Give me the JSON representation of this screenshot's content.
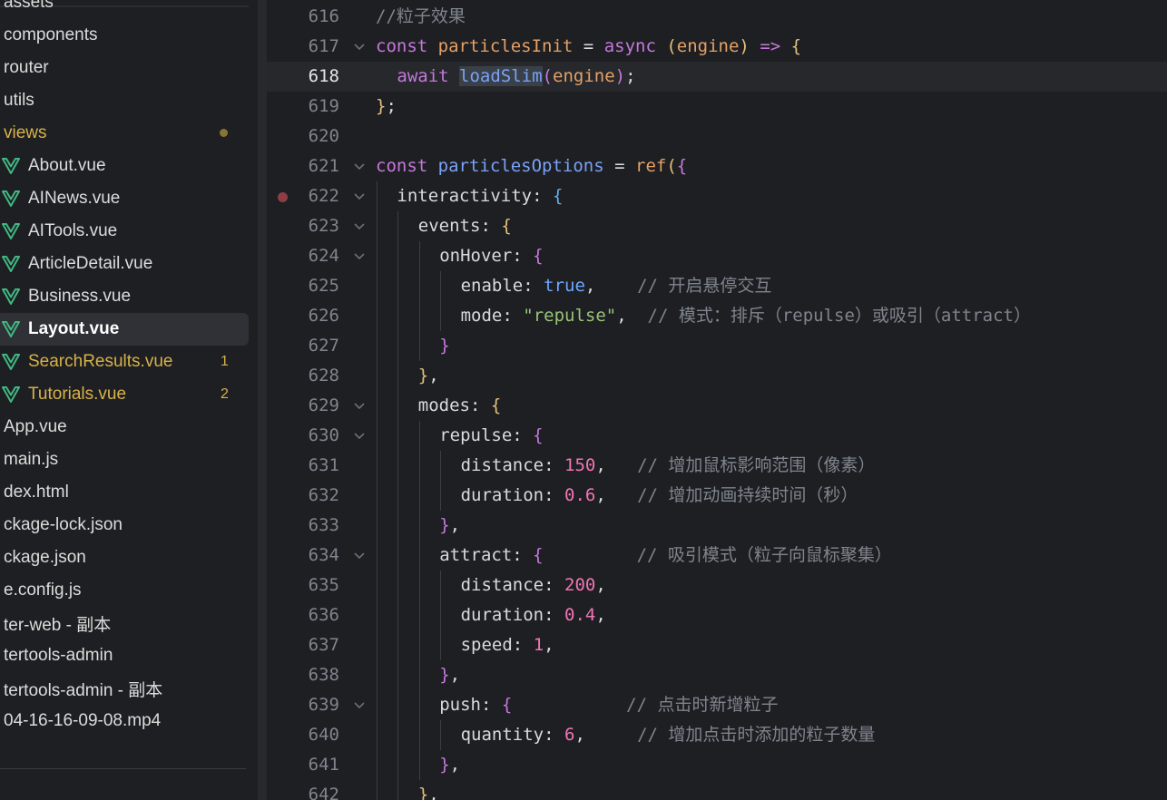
{
  "sidebar": {
    "items": [
      {
        "label": "assets",
        "type": "folder",
        "state": "normal",
        "badge": ""
      },
      {
        "label": "components",
        "type": "folder",
        "state": "normal",
        "badge": ""
      },
      {
        "label": "router",
        "type": "folder",
        "state": "normal",
        "badge": ""
      },
      {
        "label": "utils",
        "type": "folder",
        "state": "normal",
        "badge": ""
      },
      {
        "label": "views",
        "type": "folder",
        "state": "modified",
        "badge": "dot"
      },
      {
        "label": "About.vue",
        "type": "vue",
        "state": "normal",
        "badge": ""
      },
      {
        "label": "AINews.vue",
        "type": "vue",
        "state": "normal",
        "badge": ""
      },
      {
        "label": "AITools.vue",
        "type": "vue",
        "state": "normal",
        "badge": ""
      },
      {
        "label": "ArticleDetail.vue",
        "type": "vue",
        "state": "normal",
        "badge": ""
      },
      {
        "label": "Business.vue",
        "type": "vue",
        "state": "normal",
        "badge": ""
      },
      {
        "label": "Layout.vue",
        "type": "vue",
        "state": "active",
        "badge": ""
      },
      {
        "label": "SearchResults.vue",
        "type": "vue",
        "state": "modified",
        "badge": "1"
      },
      {
        "label": "Tutorials.vue",
        "type": "vue",
        "state": "modified",
        "badge": "2"
      },
      {
        "label": "App.vue",
        "type": "file",
        "state": "normal",
        "badge": ""
      },
      {
        "label": "main.js",
        "type": "file",
        "state": "normal",
        "badge": ""
      },
      {
        "label": "dex.html",
        "type": "file",
        "state": "normal",
        "badge": ""
      },
      {
        "label": "ckage-lock.json",
        "type": "file",
        "state": "normal",
        "badge": ""
      },
      {
        "label": "ckage.json",
        "type": "file",
        "state": "normal",
        "badge": ""
      },
      {
        "label": "e.config.js",
        "type": "file",
        "state": "normal",
        "badge": ""
      },
      {
        "label": "ter-web - 副本",
        "type": "folder",
        "state": "normal",
        "badge": ""
      },
      {
        "label": "tertools-admin",
        "type": "folder",
        "state": "normal",
        "badge": ""
      },
      {
        "label": "tertools-admin - 副本",
        "type": "folder",
        "state": "normal",
        "badge": ""
      },
      {
        "label": "04-16-16-09-08.mp4",
        "type": "file",
        "state": "normal",
        "badge": ""
      }
    ]
  },
  "editor": {
    "current_line": 618,
    "lines": [
      {
        "n": "616",
        "indent": 0,
        "fold": false,
        "bp": false,
        "t": [
          [
            "//粒子效果",
            "cmt"
          ]
        ]
      },
      {
        "n": "617",
        "indent": 0,
        "fold": true,
        "bp": false,
        "t": [
          [
            "const ",
            "kw"
          ],
          [
            "particlesInit",
            "fn"
          ],
          [
            " = ",
            "op"
          ],
          [
            "async ",
            "kw"
          ],
          [
            "(",
            "p1"
          ],
          [
            "engine",
            "fn"
          ],
          [
            ")",
            "p1"
          ],
          [
            " => ",
            "kw"
          ],
          [
            "{",
            "p1"
          ]
        ]
      },
      {
        "n": "618",
        "indent": 1,
        "fold": false,
        "bp": false,
        "t": [
          [
            "await ",
            "kw"
          ],
          [
            "loadSlim",
            "id hl"
          ],
          [
            "(",
            "p2"
          ],
          [
            "engine",
            "fn"
          ],
          [
            ")",
            "p2"
          ],
          [
            ";",
            "op"
          ]
        ]
      },
      {
        "n": "619",
        "indent": 0,
        "fold": false,
        "bp": false,
        "t": [
          [
            "}",
            "p1"
          ],
          [
            ";",
            "op"
          ]
        ]
      },
      {
        "n": "620",
        "indent": 0,
        "fold": false,
        "bp": false,
        "t": []
      },
      {
        "n": "621",
        "indent": 0,
        "fold": true,
        "bp": false,
        "t": [
          [
            "const ",
            "kw"
          ],
          [
            "particlesOptions",
            "id"
          ],
          [
            " = ",
            "op"
          ],
          [
            "ref",
            "fn"
          ],
          [
            "(",
            "p1"
          ],
          [
            "{",
            "p2"
          ]
        ]
      },
      {
        "n": "622",
        "indent": 1,
        "fold": true,
        "bp": true,
        "t": [
          [
            "interactivity",
            "prop"
          ],
          [
            ": ",
            "op"
          ],
          [
            "{",
            "p3"
          ]
        ]
      },
      {
        "n": "623",
        "indent": 2,
        "fold": true,
        "bp": false,
        "t": [
          [
            "events",
            "prop"
          ],
          [
            ": ",
            "op"
          ],
          [
            "{",
            "p1"
          ]
        ]
      },
      {
        "n": "624",
        "indent": 3,
        "fold": true,
        "bp": false,
        "t": [
          [
            "onHover",
            "prop"
          ],
          [
            ": ",
            "op"
          ],
          [
            "{",
            "p2"
          ]
        ]
      },
      {
        "n": "625",
        "indent": 4,
        "fold": false,
        "bp": false,
        "t": [
          [
            "enable",
            "prop"
          ],
          [
            ": ",
            "op"
          ],
          [
            "true",
            "bool"
          ],
          [
            ",    ",
            "op"
          ],
          [
            "// 开启悬停交互",
            "cmt"
          ]
        ]
      },
      {
        "n": "626",
        "indent": 4,
        "fold": false,
        "bp": false,
        "t": [
          [
            "mode",
            "prop"
          ],
          [
            ": ",
            "op"
          ],
          [
            "\"repulse\"",
            "str"
          ],
          [
            ",  ",
            "op"
          ],
          [
            "// 模式：排斥（repulse）或吸引（attract）",
            "cmt"
          ]
        ]
      },
      {
        "n": "627",
        "indent": 3,
        "fold": false,
        "bp": false,
        "t": [
          [
            "}",
            "p2"
          ]
        ]
      },
      {
        "n": "628",
        "indent": 2,
        "fold": false,
        "bp": false,
        "t": [
          [
            "}",
            "p1"
          ],
          [
            ",",
            "op"
          ]
        ]
      },
      {
        "n": "629",
        "indent": 2,
        "fold": true,
        "bp": false,
        "t": [
          [
            "modes",
            "prop"
          ],
          [
            ": ",
            "op"
          ],
          [
            "{",
            "p1"
          ]
        ]
      },
      {
        "n": "630",
        "indent": 3,
        "fold": true,
        "bp": false,
        "t": [
          [
            "repulse",
            "prop"
          ],
          [
            ": ",
            "op"
          ],
          [
            "{",
            "p2"
          ]
        ]
      },
      {
        "n": "631",
        "indent": 4,
        "fold": false,
        "bp": false,
        "t": [
          [
            "distance",
            "prop"
          ],
          [
            ": ",
            "op"
          ],
          [
            "150",
            "num"
          ],
          [
            ",   ",
            "op"
          ],
          [
            "// 增加鼠标影响范围（像素）",
            "cmt"
          ]
        ]
      },
      {
        "n": "632",
        "indent": 4,
        "fold": false,
        "bp": false,
        "t": [
          [
            "duration",
            "prop"
          ],
          [
            ": ",
            "op"
          ],
          [
            "0.6",
            "num"
          ],
          [
            ",   ",
            "op"
          ],
          [
            "// 增加动画持续时间（秒）",
            "cmt"
          ]
        ]
      },
      {
        "n": "633",
        "indent": 3,
        "fold": false,
        "bp": false,
        "t": [
          [
            "}",
            "p2"
          ],
          [
            ",",
            "op"
          ]
        ]
      },
      {
        "n": "634",
        "indent": 3,
        "fold": true,
        "bp": false,
        "t": [
          [
            "attract",
            "prop"
          ],
          [
            ": ",
            "op"
          ],
          [
            "{",
            "p2"
          ],
          [
            "         ",
            "op"
          ],
          [
            "// 吸引模式（粒子向鼠标聚集）",
            "cmt"
          ]
        ]
      },
      {
        "n": "635",
        "indent": 4,
        "fold": false,
        "bp": false,
        "t": [
          [
            "distance",
            "prop"
          ],
          [
            ": ",
            "op"
          ],
          [
            "200",
            "num"
          ],
          [
            ",",
            "op"
          ]
        ]
      },
      {
        "n": "636",
        "indent": 4,
        "fold": false,
        "bp": false,
        "t": [
          [
            "duration",
            "prop"
          ],
          [
            ": ",
            "op"
          ],
          [
            "0.4",
            "num"
          ],
          [
            ",",
            "op"
          ]
        ]
      },
      {
        "n": "637",
        "indent": 4,
        "fold": false,
        "bp": false,
        "t": [
          [
            "speed",
            "prop"
          ],
          [
            ": ",
            "op"
          ],
          [
            "1",
            "num"
          ],
          [
            ",",
            "op"
          ]
        ]
      },
      {
        "n": "638",
        "indent": 3,
        "fold": false,
        "bp": false,
        "t": [
          [
            "}",
            "p2"
          ],
          [
            ",",
            "op"
          ]
        ]
      },
      {
        "n": "639",
        "indent": 3,
        "fold": true,
        "bp": false,
        "t": [
          [
            "push",
            "prop"
          ],
          [
            ": ",
            "op"
          ],
          [
            "{",
            "p2"
          ],
          [
            "           ",
            "op"
          ],
          [
            "// 点击时新增粒子",
            "cmt"
          ]
        ]
      },
      {
        "n": "640",
        "indent": 4,
        "fold": false,
        "bp": false,
        "t": [
          [
            "quantity",
            "prop"
          ],
          [
            ": ",
            "op"
          ],
          [
            "6",
            "num"
          ],
          [
            ",     ",
            "op"
          ],
          [
            "// 增加点击时添加的粒子数量",
            "cmt"
          ]
        ]
      },
      {
        "n": "641",
        "indent": 3,
        "fold": false,
        "bp": false,
        "t": [
          [
            "}",
            "p2"
          ],
          [
            ",",
            "op"
          ]
        ]
      },
      {
        "n": "642",
        "indent": 2,
        "fold": false,
        "bp": false,
        "t": [
          [
            "}",
            "p1"
          ],
          [
            ",",
            "op"
          ]
        ]
      }
    ]
  },
  "colors": {
    "background": "#1e1f22",
    "keyword": "#c678dd",
    "string": "#98c379",
    "number": "#f075b5",
    "comment": "#7f848e",
    "modified": "#d7b24a",
    "vue_icon": "#41b883"
  },
  "icons": {
    "vue_file": "vue-logo-icon",
    "fold": "chevron-down-icon",
    "breakpoint": "breakpoint-dot-icon",
    "modified_folder": "modified-dot-icon"
  }
}
